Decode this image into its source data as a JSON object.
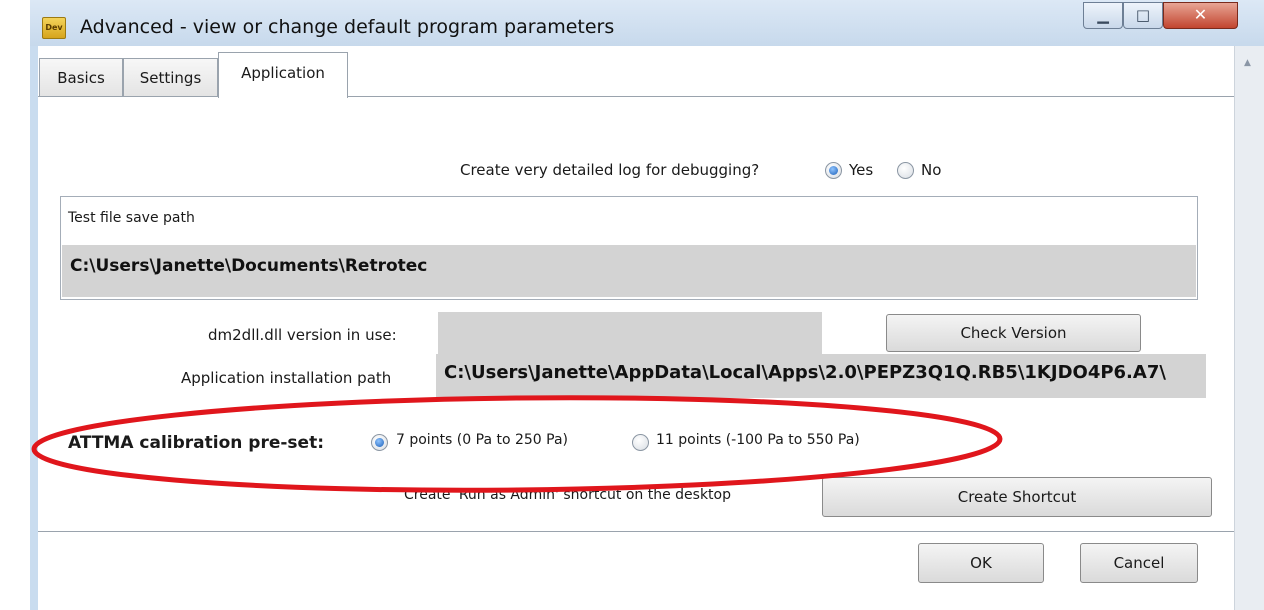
{
  "window": {
    "title": "Advanced - view or change default program parameters",
    "icon_text": "Dev"
  },
  "tabs": [
    {
      "label": "Basics",
      "active": false
    },
    {
      "label": "Settings",
      "active": false
    },
    {
      "label": "Application",
      "active": true
    }
  ],
  "debug_log": {
    "label": "Create very detailed log for debugging?",
    "options": [
      "Yes",
      "No"
    ],
    "selected": "Yes"
  },
  "test_file": {
    "group_label": "Test file save path",
    "path": "C:\\Users\\Janette\\Documents\\Retrotec"
  },
  "dll": {
    "label": "dm2dll.dll version in use:",
    "value": "",
    "check_button": "Check Version"
  },
  "install": {
    "label": "Application installation path",
    "path": "C:\\Users\\Janette\\AppData\\Local\\Apps\\2.0\\PEPZ3Q1Q.RB5\\1KJDO4P6.A7\\"
  },
  "attma": {
    "label": "ATTMA calibration pre-set:",
    "options": [
      "7 points (0 Pa to 250 Pa)",
      "11 points (-100 Pa to 550 Pa)"
    ],
    "selected": "7 points (0 Pa to 250 Pa)"
  },
  "shortcut": {
    "label": "Create 'Run as Admin' shortcut on the desktop",
    "button": "Create Shortcut"
  },
  "dialog_buttons": {
    "ok": "OK",
    "cancel": "Cancel"
  },
  "colors": {
    "annotation_ellipse": "#e0161c",
    "radio_selected": "#1c5fb8",
    "field_fill": "#d3d3d3"
  }
}
